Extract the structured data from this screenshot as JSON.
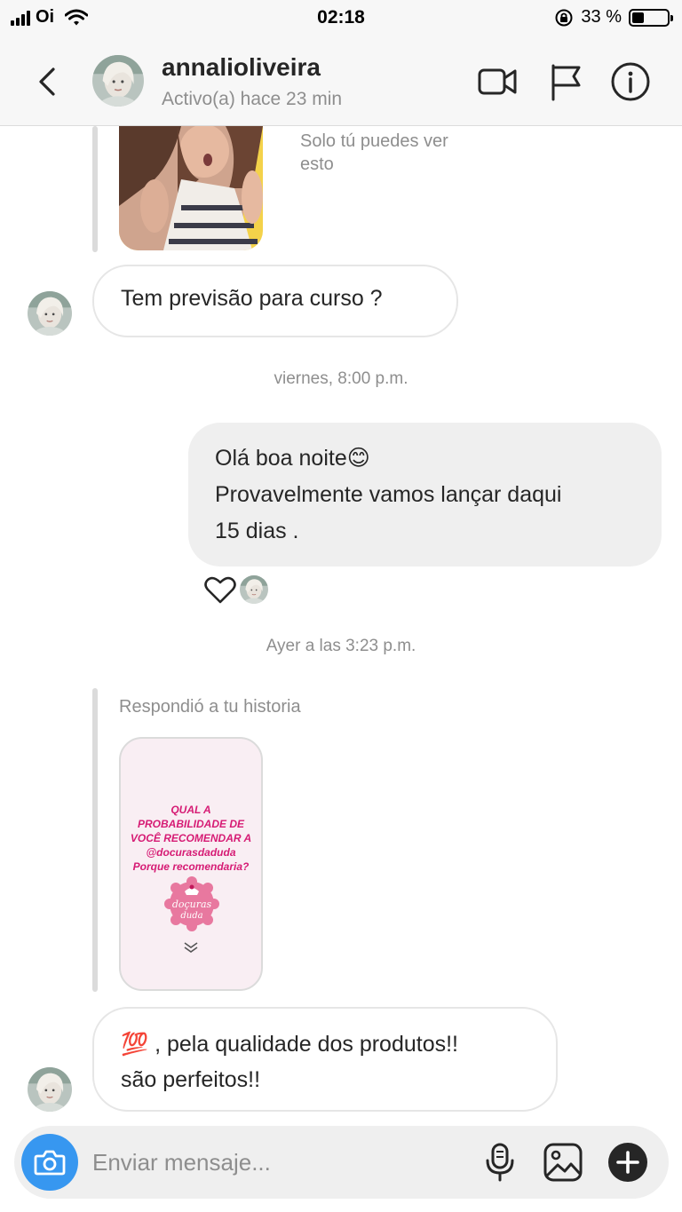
{
  "status_bar": {
    "carrier": "Oi",
    "time": "02:18",
    "battery_percent": "33 %",
    "battery_level": 0.33
  },
  "header": {
    "username": "annalioliveira",
    "active_status": "Activo(a) hace 23 min"
  },
  "story_context": {
    "private_note": "Solo tú puedes ver esto"
  },
  "messages": {
    "incoming_1": "Tem previsão para curso ?",
    "timestamp_1": "viernes, 8:00 p.m.",
    "outgoing_1_line1": "Olá boa noite",
    "outgoing_1_emoji": "😊",
    "outgoing_1_line2": "Provavelmente vamos lançar daqui",
    "outgoing_1_line3": "15 dias .",
    "timestamp_2": "Ayer a las 3:23 p.m.",
    "story_reply_label": "Respondió a tu historia",
    "story_card": {
      "line1": "QUAL A",
      "line2": "PROBABILIDADE DE",
      "line3": "VOCÊ RECOMENDAR A",
      "line4": "@docurasdaduda",
      "line5": "Porque recomendaria?",
      "logo_text": "doçuras da duda"
    },
    "incoming_2_emoji": "💯",
    "incoming_2_line1": " , pela qualidade dos produtos!!",
    "incoming_2_line2": "são perfeitos!!"
  },
  "composer": {
    "placeholder": "Enviar mensaje..."
  },
  "colors": {
    "accent_blue": "#3797f0",
    "story_pink": "#d61b74",
    "bubble_out_bg": "#efefef",
    "muted_text": "#8e8e8e"
  },
  "icons": [
    "back-chevron-icon",
    "video-call-icon",
    "flag-icon",
    "info-icon",
    "heart-icon",
    "camera-icon",
    "microphone-icon",
    "gallery-icon",
    "plus-icon"
  ]
}
